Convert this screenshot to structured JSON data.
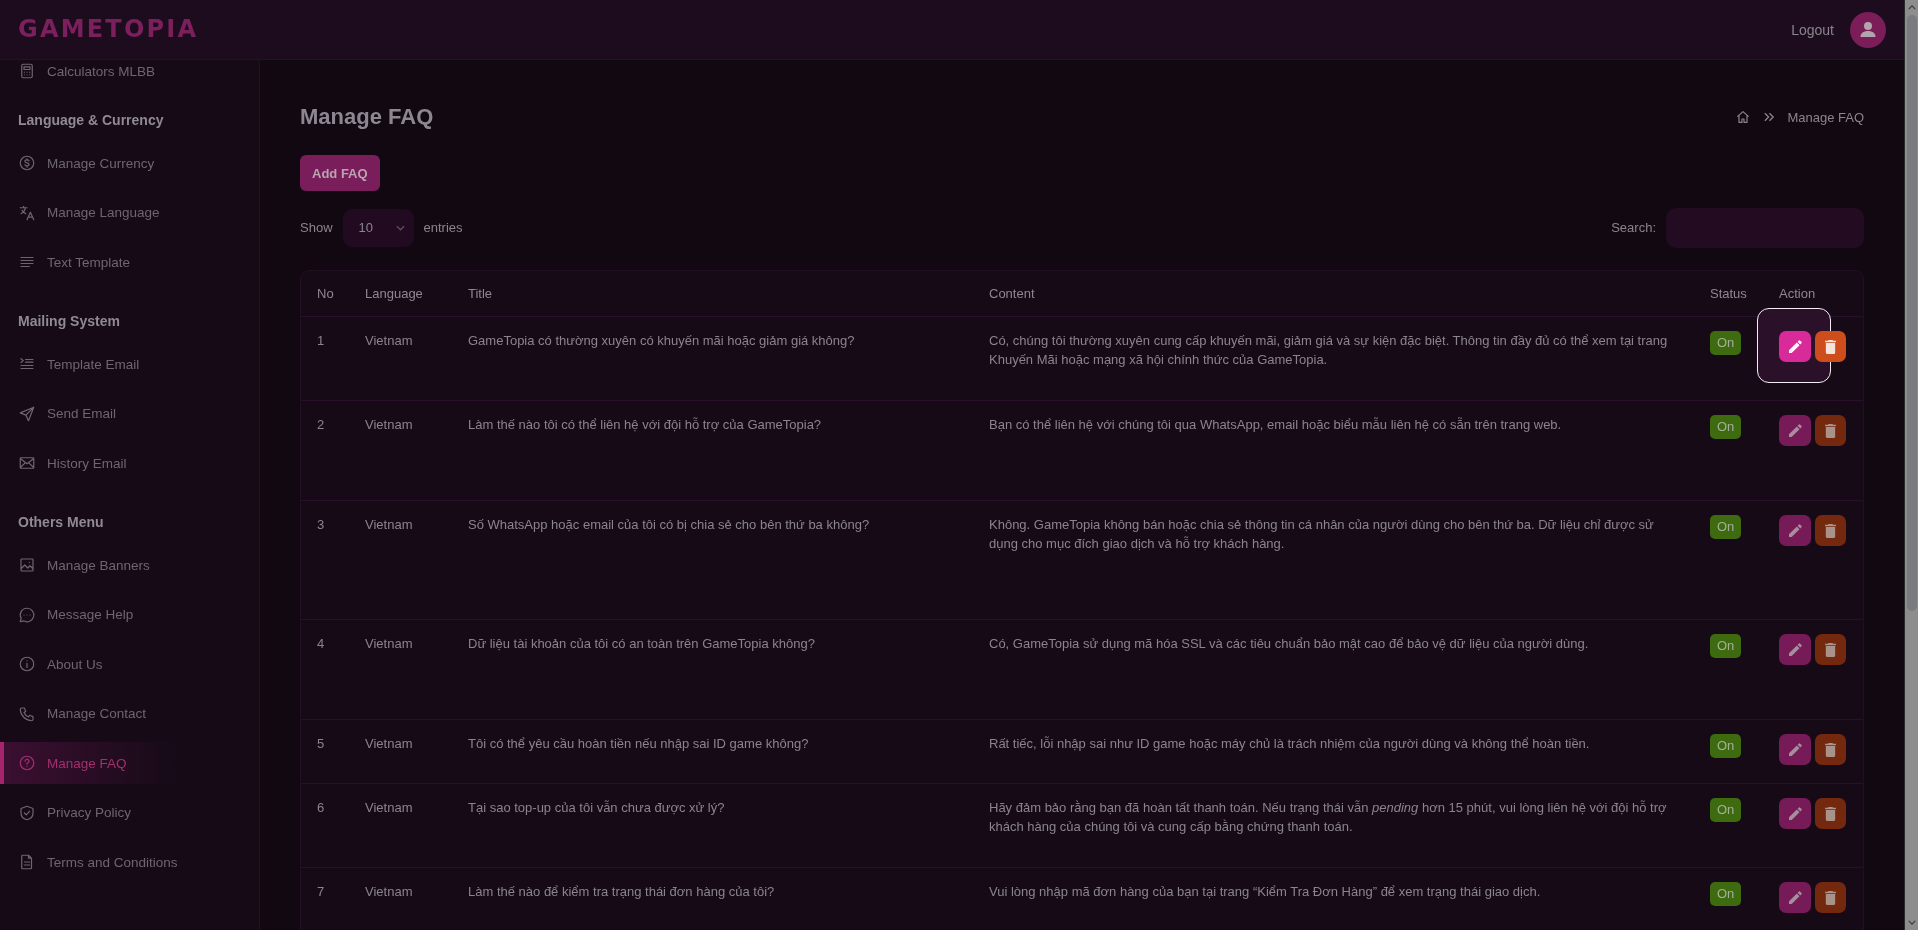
{
  "brand": {
    "logo": "GAMETOPIA"
  },
  "header": {
    "logout": "Logout"
  },
  "sidebar": {
    "groups": [
      {
        "items": [
          {
            "label": "Calculators MLBB",
            "selected": false
          }
        ]
      },
      {
        "heading": "Language & Currency",
        "items": [
          {
            "label": "Manage Currency",
            "selected": false
          },
          {
            "label": "Manage Language",
            "selected": false
          },
          {
            "label": "Text Template",
            "selected": false
          }
        ]
      },
      {
        "heading": "Mailing System",
        "items": [
          {
            "label": "Template Email",
            "selected": false
          },
          {
            "label": "Send Email",
            "selected": false
          },
          {
            "label": "History Email",
            "selected": false
          }
        ]
      },
      {
        "heading": "Others Menu",
        "items": [
          {
            "label": "Manage Banners",
            "selected": false
          },
          {
            "label": "Message Help",
            "selected": false
          },
          {
            "label": "About Us",
            "selected": false
          },
          {
            "label": "Manage Contact",
            "selected": false
          },
          {
            "label": "Manage FAQ",
            "selected": true
          },
          {
            "label": "Privacy Policy",
            "selected": false
          },
          {
            "label": "Terms and Conditions",
            "selected": false
          }
        ]
      }
    ]
  },
  "page": {
    "title": "Manage FAQ",
    "breadcrumb": {
      "current": "Manage FAQ"
    },
    "add_button": "Add FAQ",
    "length_menu": {
      "prefix": "Show",
      "value": "10",
      "suffix": "entries"
    },
    "search": {
      "label": "Search:"
    }
  },
  "table": {
    "columns": [
      "No",
      "Language",
      "Title",
      "Content",
      "Status",
      "Action"
    ],
    "rows": [
      {
        "no": "1",
        "language": "Vietnam",
        "title": "GameTopia có thường xuyên có khuyến mãi hoặc giảm giá không?",
        "content": "Có, chúng tôi thường xuyên cung cấp khuyến mãi, giảm giá và sự kiện đặc biệt. Thông tin đầy đủ có thể xem tại trang Khuyến Mãi hoặc mạng xã hội chính thức của GameTopia.",
        "status": "On",
        "edit_spotlight": true
      },
      {
        "no": "2",
        "language": "Vietnam",
        "title": "Làm thế nào tôi có thể liên hệ với đội hỗ trợ của GameTopia?",
        "content": "Bạn có thể liên hệ với chúng tôi qua WhatsApp, email hoặc biểu mẫu liên hệ có sẵn trên trang web.",
        "status": "On",
        "edit_spotlight": false
      },
      {
        "no": "3",
        "language": "Vietnam",
        "title": "Số WhatsApp hoặc email của tôi có bị chia sẻ cho bên thứ ba không?",
        "content": "Không. GameTopia không bán hoặc chia sẻ thông tin cá nhân của người dùng cho bên thứ ba. Dữ liệu chỉ được sử dụng cho mục đích giao dịch và hỗ trợ khách hàng.",
        "status": "On",
        "edit_spotlight": false
      },
      {
        "no": "4",
        "language": "Vietnam",
        "title": "Dữ liệu tài khoản của tôi có an toàn trên GameTopia không?",
        "content": "Có, GameTopia sử dụng mã hóa SSL và các tiêu chuẩn bảo mật cao để bảo vệ dữ liệu của người dùng.",
        "status": "On",
        "edit_spotlight": false
      },
      {
        "no": "5",
        "language": "Vietnam",
        "title": "Tôi có thể yêu cầu hoàn tiền nếu nhập sai ID game không?",
        "content": "Rất tiếc, lỗi nhập sai như ID game hoặc máy chủ là trách nhiệm của người dùng và không thể hoàn tiền.",
        "status": "On",
        "edit_spotlight": false
      },
      {
        "no": "6",
        "language": "Vietnam",
        "title": "Tại sao top-up của tôi vẫn chưa được xử lý?",
        "content": "Hãy đảm bảo rằng bạn đã hoàn tất thanh toán. Nếu trạng thái vẫn *pending* hơn 15 phút, vui lòng liên hệ với đội hỗ trợ khách hàng của chúng tôi và cung cấp bằng chứng thanh toán.",
        "status": "On",
        "edit_spotlight": false
      },
      {
        "no": "7",
        "language": "Vietnam",
        "title": "Làm thế nào để kiểm tra trạng thái đơn hàng của tôi?",
        "content": "Vui lòng nhập mã đơn hàng của bạn tại trang “Kiểm Tra Đơn Hàng” để xem trạng thái giao dịch.",
        "status": "On",
        "edit_spotlight": false
      }
    ]
  }
}
